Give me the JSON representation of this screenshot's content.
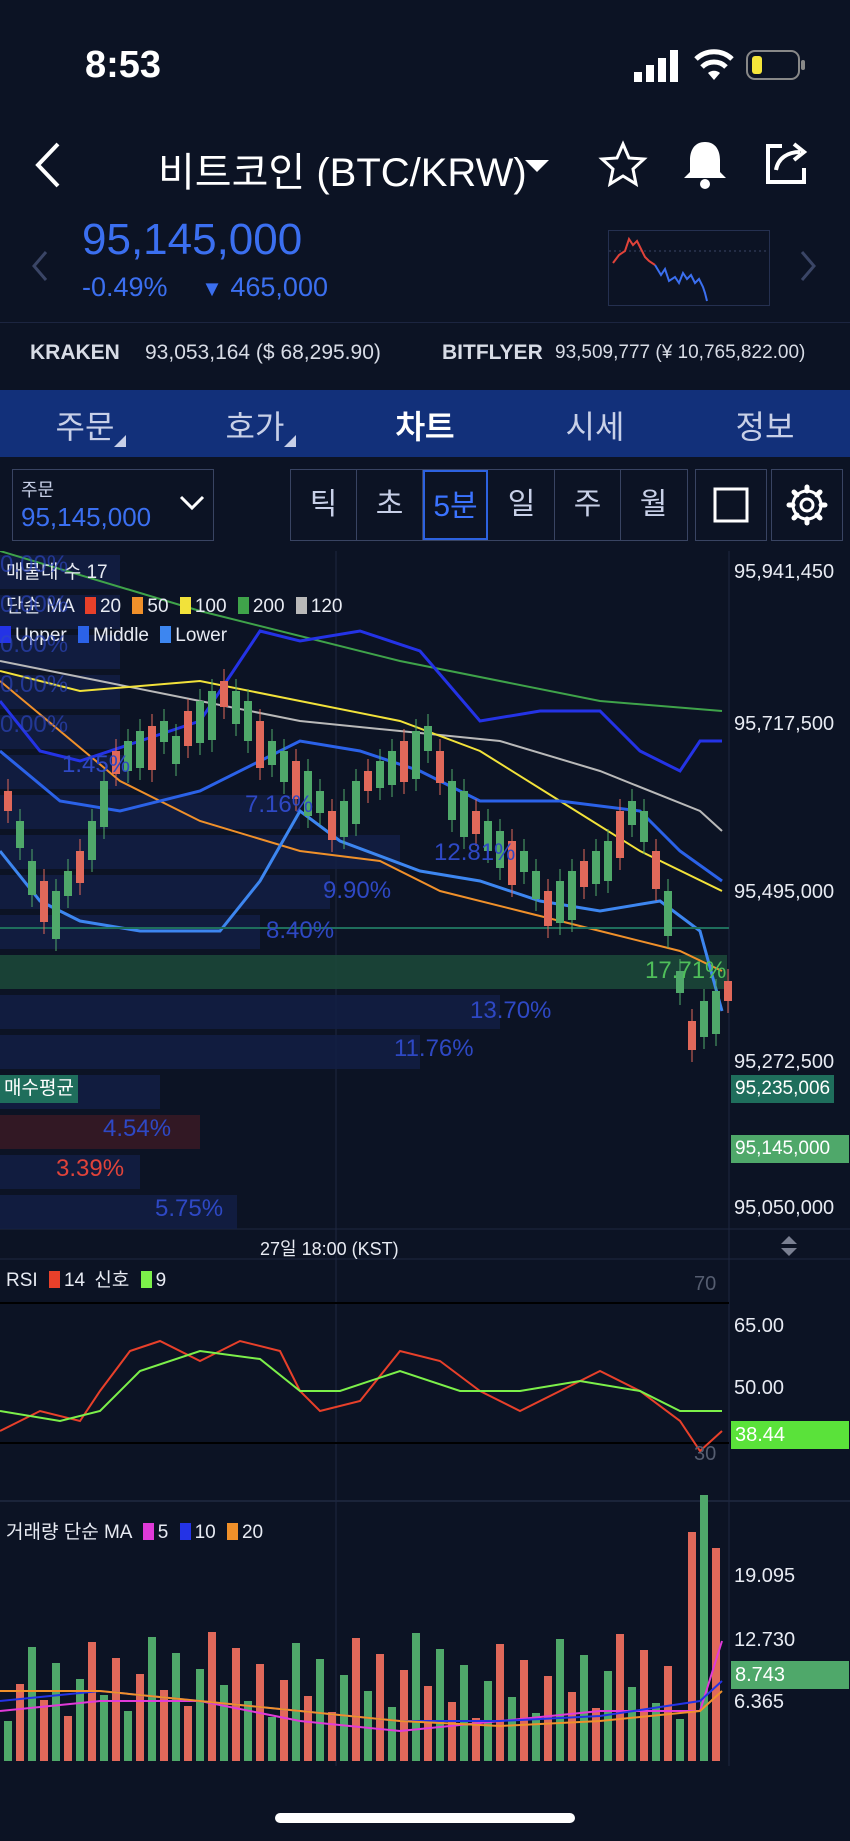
{
  "status": {
    "time": "8:53"
  },
  "header": {
    "title": "비트코인 (BTC/KRW)"
  },
  "ticker": {
    "price": "95,145,000",
    "change_pct": "-0.49%",
    "change_arrow": "▼",
    "change_abs": "465,000"
  },
  "exchanges": [
    {
      "name": "KRAKEN",
      "value": "93,053,164 ($ 68,295.90)"
    },
    {
      "name": "BITFLYER",
      "value": "93,509,777 (¥ 10,765,822.00)"
    }
  ],
  "tabs": [
    "주문",
    "호가",
    "차트",
    "시세",
    "정보"
  ],
  "active_tab": "차트",
  "order_box": {
    "label": "주문",
    "value": "95,145,000"
  },
  "intervals": [
    "틱",
    "초",
    "5분",
    "일",
    "주",
    "월"
  ],
  "active_interval": "5분",
  "main_chart": {
    "legend_volume_profile": "매물대 수 17",
    "legend_ma_prefix": "단순 MA",
    "ma": [
      {
        "label": "20",
        "color": "#e8402a"
      },
      {
        "label": "50",
        "color": "#f0902a"
      },
      {
        "label": "100",
        "color": "#f2e23a"
      },
      {
        "label": "200",
        "color": "#3fa34a"
      },
      {
        "label": "120",
        "color": "#b9b9b9"
      }
    ],
    "bollinger": [
      {
        "label": "Upper",
        "color": "#2433e6"
      },
      {
        "label": "Middle",
        "color": "#2b62e8"
      },
      {
        "label": "Lower",
        "color": "#3d86f0"
      }
    ],
    "y_ticks": [
      "95,941,450",
      "95,717,500",
      "95,495,000",
      "95,272,500",
      "95,050,000"
    ],
    "avg_buy_label": "매수평균",
    "avg_buy_value": "95,235,006",
    "current_price_tag": "95,145,000",
    "profile_pcts": [
      "0.00%",
      "0.00%",
      "0.00%",
      "0.00%",
      "0.00%",
      "1.45%",
      "7.16%",
      "12.81%",
      "9.90%",
      "8.40%",
      "17.71%",
      "13.70%",
      "11.76%",
      "4.54%",
      "3.39%",
      "5.75%"
    ],
    "time_label": "27일 18:00 (KST)"
  },
  "rsi": {
    "legend_prefix": "RSI",
    "period": "14",
    "signal_label": "신호",
    "signal": "9",
    "y_ticks": [
      "70",
      "65.00",
      "50.00",
      "30"
    ],
    "current": "38.44"
  },
  "volume": {
    "legend_prefix": "거래량 단순 MA",
    "ma": [
      {
        "label": "5",
        "color": "#e03ad8"
      },
      {
        "label": "10",
        "color": "#2433e6"
      },
      {
        "label": "20",
        "color": "#f0902a"
      }
    ],
    "y_ticks": [
      "19.095",
      "12.730",
      "6.365"
    ],
    "current": "8.743"
  },
  "colors": {
    "accent": "#3b6ff0",
    "up": "#4fa86a",
    "down": "#e0685a",
    "bg": "#0c1324"
  }
}
